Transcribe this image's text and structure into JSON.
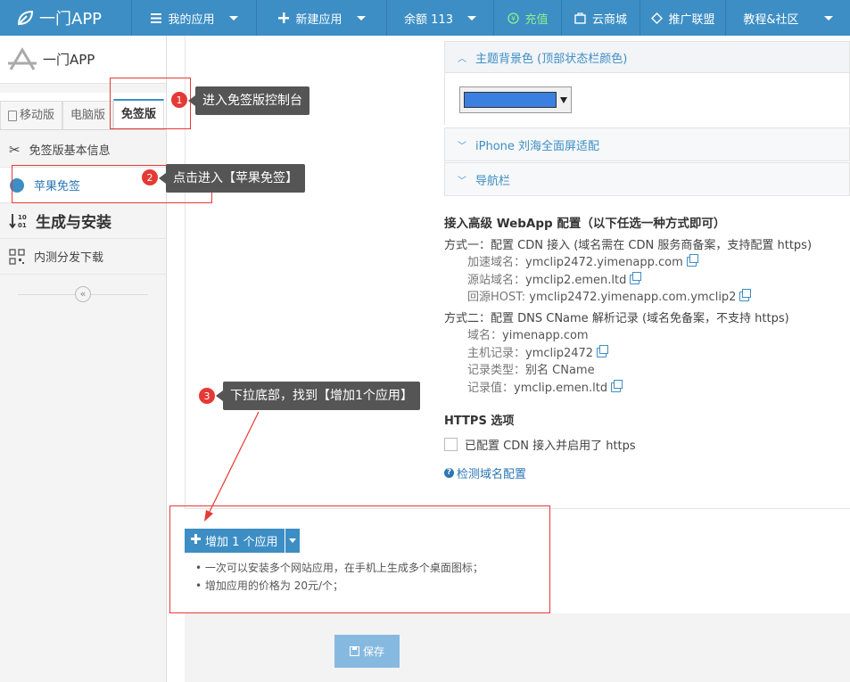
{
  "topnav": {
    "brand": "一门APP",
    "items": [
      {
        "label": "我的应用",
        "icon": "list-icon",
        "dropdown": true
      },
      {
        "label": "新建应用",
        "icon": "plus-icon",
        "dropdown": true
      },
      {
        "label": "余额 113",
        "icon": "",
        "dropdown": true
      },
      {
        "label": "充值",
        "icon": "recharge-icon",
        "dropdown": false
      },
      {
        "label": "云商城",
        "icon": "shop-icon",
        "dropdown": false
      },
      {
        "label": "推广联盟",
        "icon": "diamond-icon",
        "dropdown": false
      },
      {
        "label": "教程&社区",
        "icon": "",
        "dropdown": true
      }
    ],
    "colors": {
      "bar": "#3d8ec4",
      "recharge": "#8ef08e"
    }
  },
  "sidebar": {
    "logo_text": "一门APP",
    "tabs": [
      "移动版",
      "电脑版",
      "免签版"
    ],
    "menu": [
      {
        "label": "免签版基本信息",
        "icon": "scissors-icon"
      },
      {
        "label": "苹果免签",
        "icon": "compass-icon"
      },
      {
        "label": "生成与安装",
        "icon": "sort-icon"
      },
      {
        "label": "内测分发下载",
        "icon": "qrcode-icon"
      }
    ],
    "collapse_glyph": "«"
  },
  "panels": {
    "theme_bg": "主题背景色 (顶部状态栏颜色)",
    "theme_color": "#3b7fe0",
    "iphone": "iPhone 刘海全面屏适配",
    "navbar": "导航栏"
  },
  "config": {
    "title": "接入高级 WebApp 配置（以下任选一种方式即可）",
    "method1": "方式一：配置 CDN 接入 (域名需在 CDN 服务商备案，支持配置 https)",
    "m1_rows": [
      {
        "k": "加速域名：",
        "v": "ymclip2472.yimenapp.com"
      },
      {
        "k": "源站域名：",
        "v": "ymclip2.emen.ltd"
      },
      {
        "k": "回源HOST: ",
        "v": "ymclip2472.yimenapp.com.ymclip2"
      }
    ],
    "method2": "方式二：配置 DNS CName 解析记录 (域名免备案，不支持 https)",
    "m2_rows": [
      {
        "k": "域名：",
        "v": "yimenapp.com",
        "copy": false
      },
      {
        "k": "主机记录：",
        "v": "ymclip2472",
        "copy": true
      },
      {
        "k": "记录类型：",
        "v": "别名 CName",
        "copy": false
      },
      {
        "k": "记录值：",
        "v": "ymclip.emen.ltd",
        "copy": true
      }
    ]
  },
  "https": {
    "title": "HTTPS 选项",
    "checkbox_label": "已配置 CDN 接入并启用了 https",
    "detect_link": "检测域名配置"
  },
  "add_app": {
    "button": "增加 1 个应用",
    "notes": [
      "• 一次可以安装多个网站应用，在手机上生成多个桌面图标；",
      "• 增加应用的价格为 20元/个；"
    ]
  },
  "save_button": "保存",
  "annotations": [
    {
      "num": "1",
      "text": "进入免签版控制台"
    },
    {
      "num": "2",
      "text": "点击进入【苹果免签】"
    },
    {
      "num": "3",
      "text": "下拉底部，找到【增加1个应用】"
    }
  ]
}
